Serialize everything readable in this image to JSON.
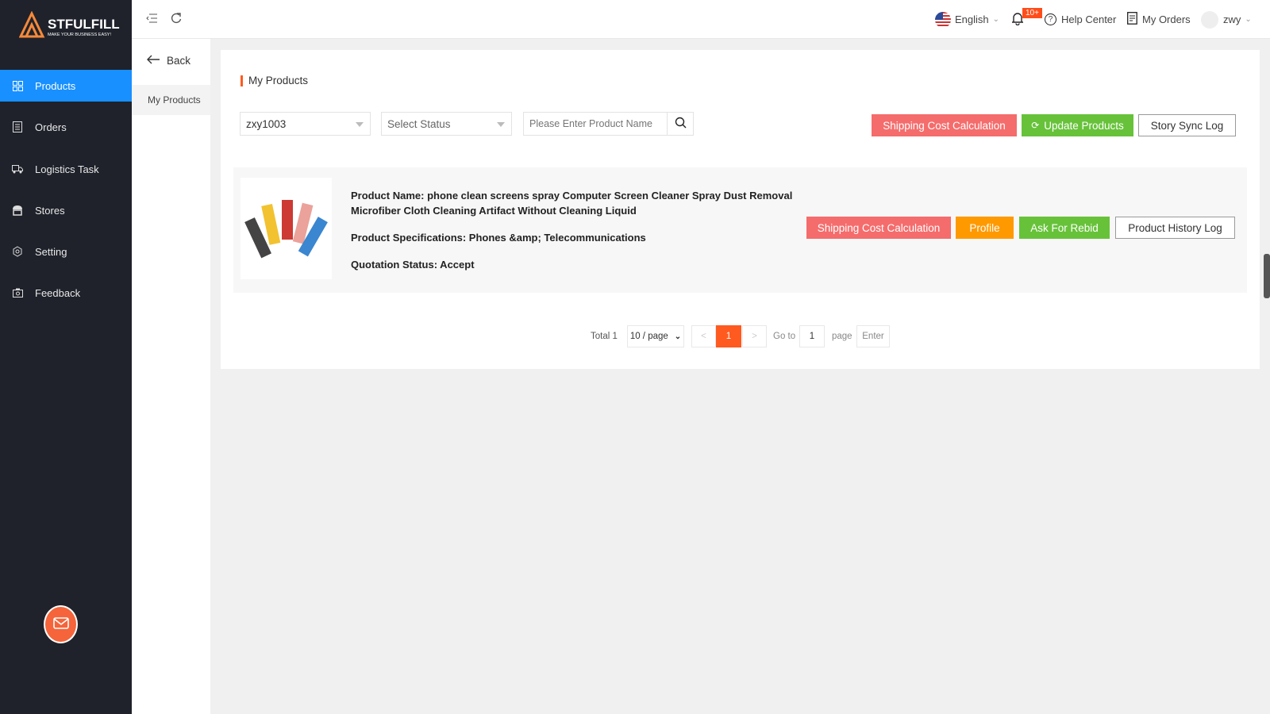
{
  "brand": {
    "name": "STFULFILL",
    "tagline": "MAKE YOUR BUSINESS EASY!",
    "accent": "#f5893a"
  },
  "sidebar": {
    "items": [
      {
        "label": "Products",
        "icon": "grid-icon",
        "active": true
      },
      {
        "label": "Orders",
        "icon": "document-icon"
      },
      {
        "label": "Logistics Task",
        "icon": "truck-icon"
      },
      {
        "label": "Stores",
        "icon": "store-icon"
      },
      {
        "label": "Setting",
        "icon": "gear-icon"
      },
      {
        "label": "Feedback",
        "icon": "camera-icon"
      }
    ]
  },
  "header": {
    "language": "English",
    "notification_badge": "10+",
    "help": "Help Center",
    "orders": "My Orders",
    "user": "zwy"
  },
  "subnav": {
    "back": "Back",
    "items": [
      "My Products"
    ]
  },
  "main": {
    "title": "My Products",
    "filters": {
      "store_value": "zxy1003",
      "status_placeholder": "Select Status",
      "search_placeholder": "Please Enter Product Name"
    },
    "actions": {
      "shipping": "Shipping Cost Calculation",
      "update": "Update Products",
      "sync_log": "Story Sync Log"
    },
    "products": [
      {
        "name_line1": "Product Name: phone clean screens spray Computer Screen Cleaner Spray Dust Removal",
        "name_line2": "Microfiber Cloth Cleaning Artifact Without Cleaning Liquid",
        "specs": "Product Specifications: Phones &amp; Telecommunications",
        "status": "Quotation Status: Accept",
        "buttons": {
          "shipping": "Shipping Cost Calculation",
          "profile": "Profile",
          "rebid": "Ask For Rebid",
          "history": "Product History Log"
        }
      }
    ],
    "pagination": {
      "total": "Total 1",
      "page_size": "10 / page",
      "prev": "<",
      "current": "1",
      "next": ">",
      "goto": "Go to",
      "goto_value": "1",
      "page": "page",
      "enter": "Enter"
    }
  },
  "colors": {
    "primary": "#1890ff",
    "danger": "#f56c6c",
    "success": "#67c23a",
    "warning": "#ff9900",
    "page_active": "#ff5a1f"
  }
}
